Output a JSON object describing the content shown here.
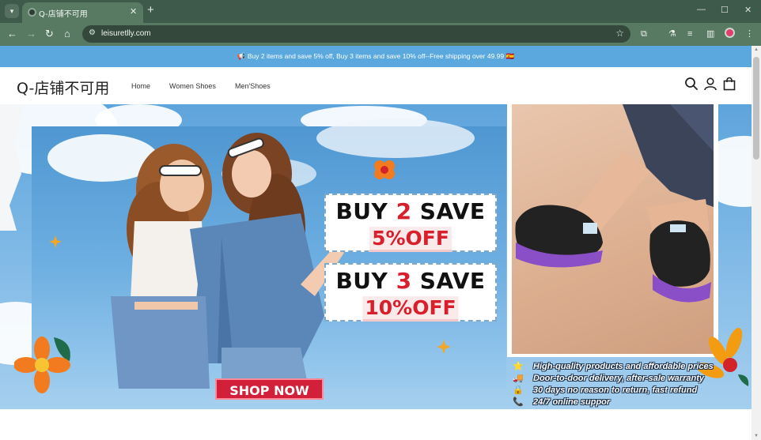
{
  "browser": {
    "tab_title": "Q-店铺不可用",
    "url": "leisuretlly.com"
  },
  "announcement": {
    "text": "Buy 2 items and save 5% off, Buy 3 items and save 10% off--Free shipping over 49.99",
    "background_color": "#5aa8de"
  },
  "header": {
    "logo": "Q-店铺不可用",
    "nav": [
      "Home",
      "Women Shoes",
      "Men'Shoes"
    ]
  },
  "hero": {
    "offer1": {
      "prefix": "BUY ",
      "num": "2",
      "suffix": " SAVE",
      "discount": "5%OFF"
    },
    "offer2": {
      "prefix": "BUY ",
      "num": "3",
      "suffix": " SAVE",
      "discount": "10%OFF"
    },
    "cta_label": "SHOP NOW",
    "cta_color": "#d21f3a",
    "features": [
      {
        "icon": "star-icon",
        "text": "High-quality products and affordable prices"
      },
      {
        "icon": "truck-icon",
        "text": "Door-to-door delivery, after-sale warranty"
      },
      {
        "icon": "lock-icon",
        "text": "30 days no reason to return, fast refund"
      },
      {
        "icon": "phone-icon",
        "text": "24/7 online suppor"
      }
    ]
  },
  "colors": {
    "chrome": "#3e5a4a",
    "toolbar": "#587a62",
    "accent_red": "#d81f2b"
  }
}
